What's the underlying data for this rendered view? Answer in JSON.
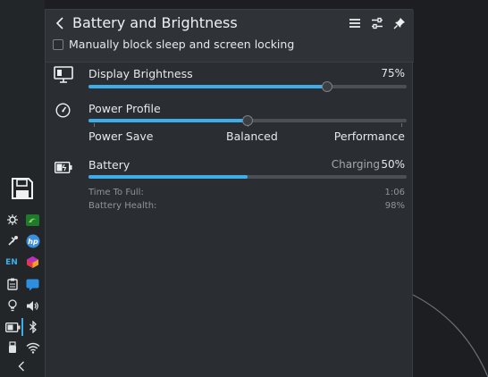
{
  "header": {
    "title": "Battery and Brightness",
    "checkbox_label": "Manually block sleep and screen locking",
    "checkbox_checked": false
  },
  "display": {
    "label": "Display Brightness",
    "value_text": "75%",
    "level": 0.75
  },
  "power_profile": {
    "label": "Power Profile",
    "options": [
      "Power Save",
      "Balanced",
      "Performance"
    ],
    "selected": "Balanced"
  },
  "battery": {
    "label": "Battery",
    "status": "Charging",
    "percent_text": "50%",
    "level": 0.5,
    "details": [
      {
        "label": "Time To Full:",
        "value": "1:06"
      },
      {
        "label": "Battery Health:",
        "value": "98%"
      }
    ]
  },
  "taskbar": {
    "language": "EN",
    "icons": [
      "save-icon",
      "kde-connect-icon",
      "nvidia-icon",
      "bluetooth-devices-icon",
      "hp-icon",
      "keyboard-layout-icon",
      "cube-app-icon",
      "clipboard-icon",
      "chat-icon",
      "lightbulb-icon",
      "volume-icon",
      "battery-icon",
      "bluetooth-icon",
      "usb-icon",
      "wifi-icon",
      "expand-tray-icon"
    ]
  },
  "colors": {
    "accent": "#3daee9",
    "panel": "#2a2e32",
    "background": "#1c1e21"
  }
}
